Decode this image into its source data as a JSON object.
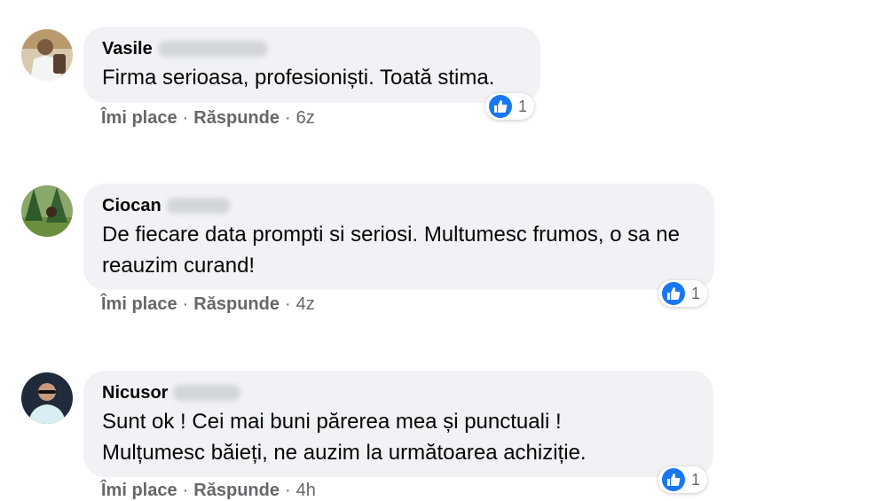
{
  "comments": [
    {
      "author": "Vasile",
      "text": "Firma serioasa, profesioniști. Toată stima.",
      "reaction_count": "1",
      "like_label": "Îmi place",
      "reply_label": "Răspunde",
      "separator": "·",
      "time": "6z"
    },
    {
      "author": "Ciocan",
      "text": "De fiecare data prompti si seriosi. Multumesc frumos, o sa ne reauzim curand!",
      "reaction_count": "1",
      "like_label": "Îmi place",
      "reply_label": "Răspunde",
      "separator": "·",
      "time": "4z"
    },
    {
      "author": "Nicusor",
      "text": "Sunt ok ! Cei mai buni părerea mea și punctuali ! Mulțumesc băieți, ne auzim la următoarea achiziție.",
      "reaction_count": "1",
      "like_label": "Îmi place",
      "reply_label": "Răspunde",
      "separator": "·",
      "time": "4h"
    }
  ],
  "colors": {
    "bubble": "#f0f2f5",
    "like_blue": "#1877f2",
    "meta_grey": "#65676b"
  },
  "icons": [
    "avatar",
    "like-reaction-icon"
  ]
}
